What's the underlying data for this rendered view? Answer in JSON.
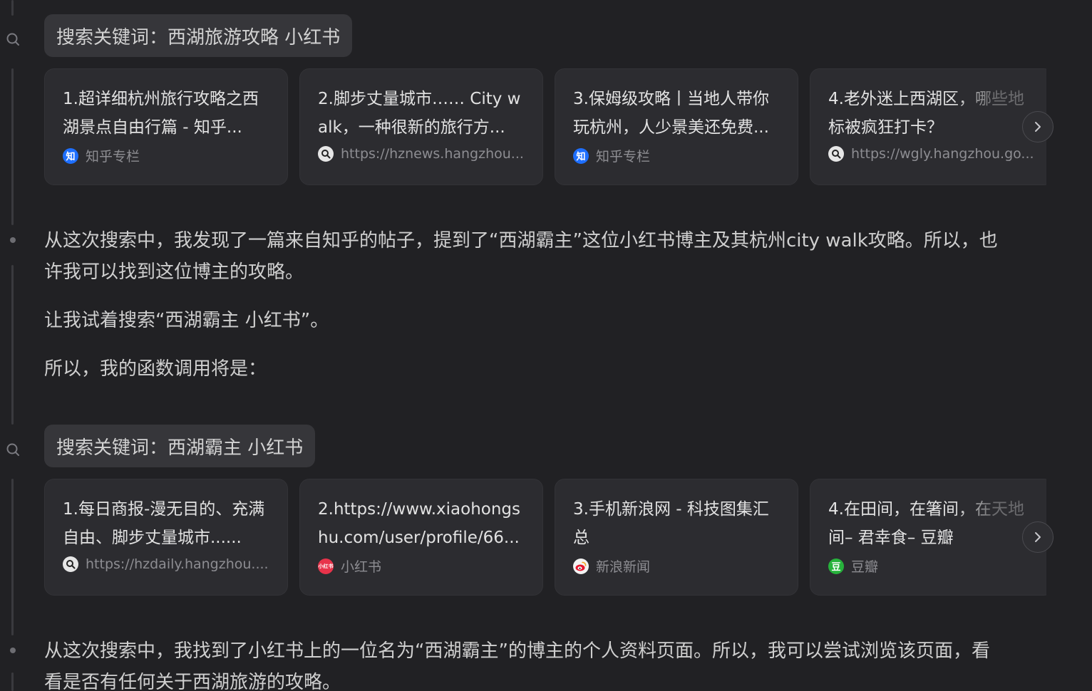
{
  "search1": {
    "keyword": "搜索关键词：西湖旅游攻略 小红书",
    "cards": [
      {
        "title": "1.超详细杭州旅行攻略之西湖景点自由行篇 - 知乎...",
        "source": "知乎专栏",
        "icon": "zhihu-icon",
        "icon_text": "知"
      },
      {
        "title": "2.脚步丈量城市…… City walk，一种很新的旅行方...",
        "source": "https://hznews.hangzhou...",
        "icon": "search-source-icon",
        "icon_text": ""
      },
      {
        "title": "3.保姆级攻略丨当地人带你玩杭州，人少景美还免费...",
        "source": "知乎专栏",
        "icon": "zhihu-icon",
        "icon_text": "知"
      },
      {
        "title": "4.老外迷上西湖区，哪些地标被疯狂打卡？",
        "source": "https://wgly.hangzhou.go...",
        "icon": "search-source-icon",
        "icon_text": ""
      }
    ]
  },
  "thought1": {
    "p1": "从这次搜索中，我发现了一篇来自知乎的帖子，提到了“西湖霸主”这位小红书博主及其杭州city walk攻略。所以，也许我可以找到这位博主的攻略。",
    "p2": "让我试着搜索“西湖霸主 小红书”。",
    "p3": "所以，我的函数调用将是："
  },
  "search2": {
    "keyword": "搜索关键词：西湖霸主 小红书",
    "cards": [
      {
        "title": "1.每日商报-漫无目的、充满自由、脚步丈量城市......",
        "source": "https://hzdaily.hangzhou....",
        "icon": "search-source-icon",
        "icon_text": ""
      },
      {
        "title": "2.https://www.xiaohongshu.com/user/profile/66...",
        "source": "小红书",
        "icon": "xiaohongshu-icon",
        "icon_text": "小红书"
      },
      {
        "title": "3.手机新浪网 - 科技图集汇总",
        "source": "新浪新闻",
        "icon": "sina-icon",
        "icon_text": ""
      },
      {
        "title": "4.在田间，在箸间，在天地间– 君幸食– 豆瓣",
        "source": "豆瓣",
        "icon": "douban-icon",
        "icon_text": "豆"
      }
    ]
  },
  "thought2": {
    "p1": "从这次搜索中，我找到了小红书上的一位名为“西湖霸主”的博主的个人资料页面。所以，我可以尝试浏览该页面，看看是否有任何关于西湖旅游的攻略。"
  },
  "colors": {
    "background": "#212124",
    "card": "#2c2c30",
    "chip": "#36363a",
    "text": "#d8d8d8",
    "muted": "#8d8d92"
  }
}
